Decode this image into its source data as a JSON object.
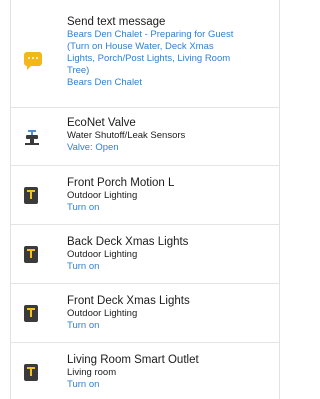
{
  "items": [
    {
      "title": "Send text message",
      "lines": [
        "Bears Den Chalet - Preparing for Guest",
        "(Turn on House Water, Deck Xmas",
        "Lights, Porch/Post Lights, Living Room",
        "Tree)",
        "Bears Den Chalet"
      ],
      "icon": "message-icon"
    },
    {
      "title": "EcoNet Valve",
      "subtitle": "Water Shutoff/Leak Sensors",
      "action": "Valve: Open",
      "icon": "valve-icon"
    },
    {
      "title": "Front Porch Motion L",
      "subtitle": "Outdoor Lighting",
      "action": "Turn on",
      "icon": "light-switch-icon"
    },
    {
      "title": "Back Deck Xmas Lights",
      "subtitle": "Outdoor Lighting",
      "action": "Turn on",
      "icon": "light-switch-icon"
    },
    {
      "title": "Front Deck Xmas Lights",
      "subtitle": "Outdoor Lighting",
      "action": "Turn on",
      "icon": "light-switch-icon"
    },
    {
      "title": "Living Room Smart Outlet",
      "subtitle": "Living room",
      "action": "Turn on",
      "icon": "light-switch-icon"
    }
  ],
  "colors": {
    "link": "#2f7fd6",
    "message_icon": "#f4b71a",
    "switch_icon": "#3a3a3a"
  }
}
